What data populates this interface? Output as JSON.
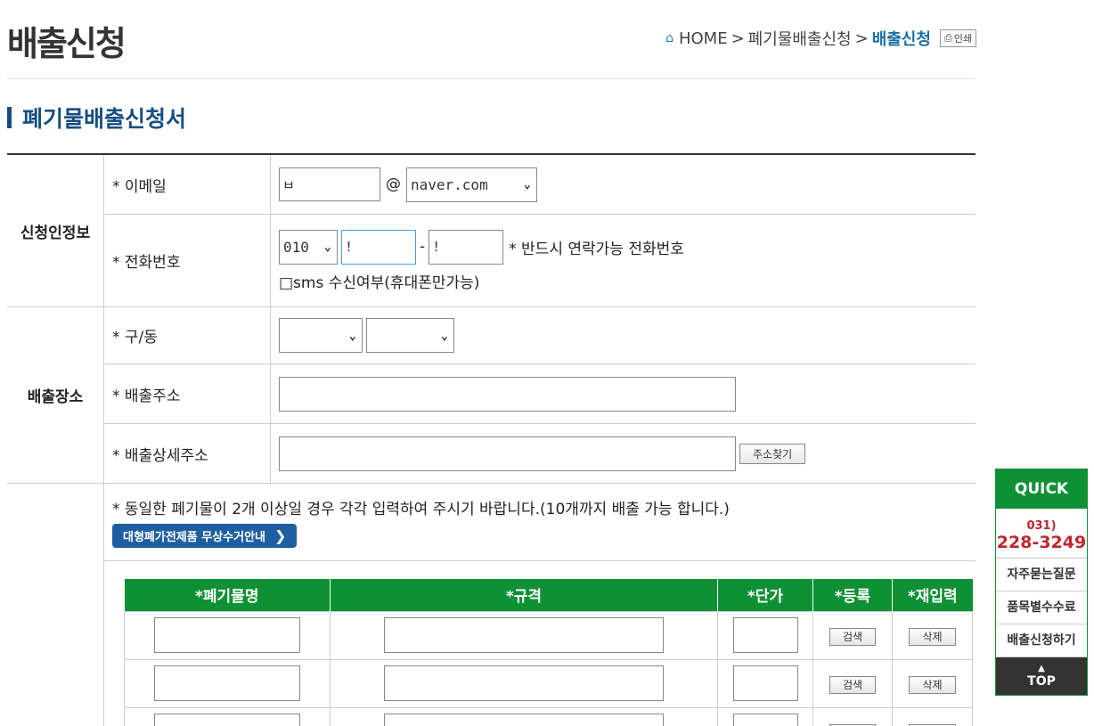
{
  "header": {
    "title": "배출신청",
    "breadcrumb": {
      "home": "HOME",
      "sep": ">",
      "parent": "폐기물배출신청",
      "current": "배출신청",
      "print": "인쇄"
    }
  },
  "section_title": "폐기물배출신청서",
  "applicant": {
    "group_label": "신청인정보",
    "email_label": "* 이메일",
    "email_local": "ㅂ",
    "at": "@",
    "email_domain": "naver.com",
    "phone_label": "* 전화번호",
    "phone_prefix": "010",
    "phone_mid": "!",
    "phone_dash": "-",
    "phone_last": "!",
    "phone_note": "* 반드시 연락가능 전화번호",
    "sms_label": "□sms 수신여부(휴대폰만가능)"
  },
  "location": {
    "group_label": "배출장소",
    "gu_dong_label": "* 구/동",
    "gu_value": "",
    "dong_value": "",
    "address_label": "* 배출주소",
    "detail_label": "* 배출상세주소",
    "find_button": "주소찾기"
  },
  "items": {
    "notice": "* 동일한 폐기물이 2개 이상일 경우 각각 입력하여 주시기 바랍니다.(10개까지 배출 가능 합니다.)",
    "guide_button": "대형폐가전제품 무상수거안내",
    "columns": [
      "*폐기물명",
      "*규격",
      "*단가",
      "*등록",
      "*재입력"
    ],
    "search_label": "검색",
    "delete_label": "삭제"
  },
  "quick": {
    "title": "QUICK",
    "area_code": "031)",
    "phone": "228-3249",
    "links": [
      "자주묻는질문",
      "품목별수수료",
      "배출신청하기"
    ],
    "top": "TOP"
  }
}
